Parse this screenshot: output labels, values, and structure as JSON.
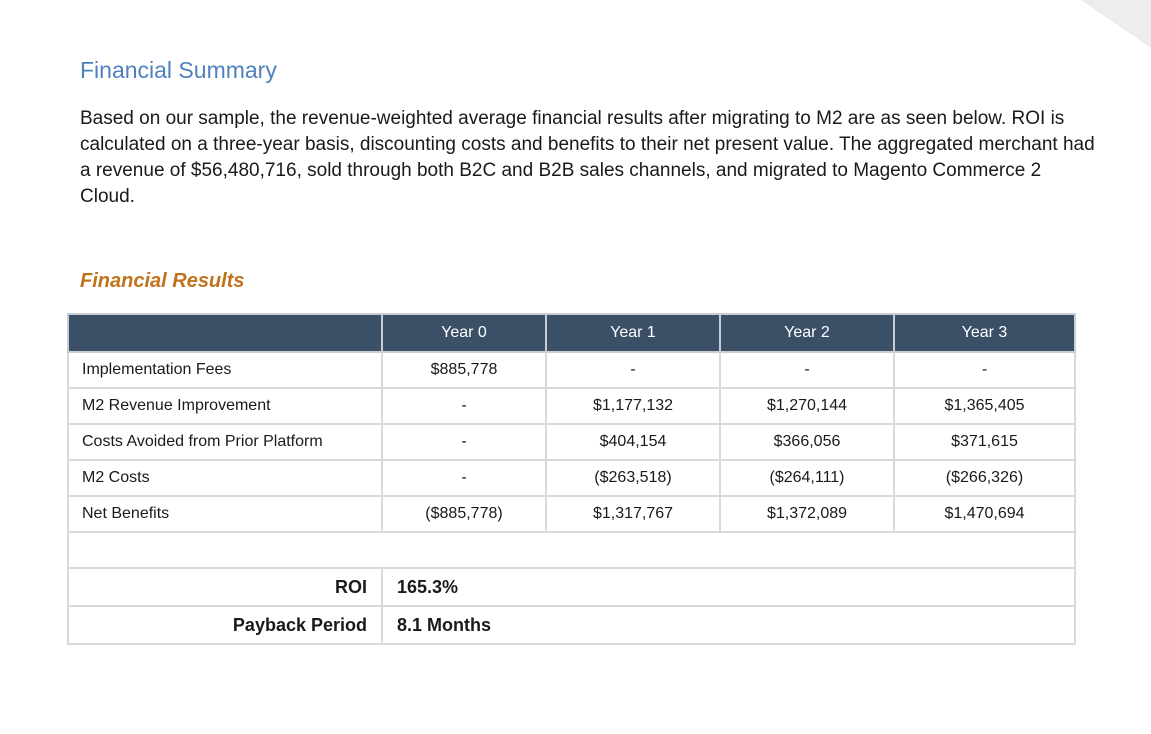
{
  "document": {
    "section_title": "Financial Summary",
    "intro_text": "Based on our sample, the revenue-weighted average financial results after migrating to M2 are as seen below. ROI is calculated on a three-year basis, discounting costs and benefits to their net present value. The aggregated merchant had a revenue of $56,480,716, sold through both B2C and B2B sales channels, and migrated to Magento Commerce 2 Cloud.",
    "table_title": "Financial Results"
  },
  "table": {
    "headers": [
      "",
      "Year 0",
      "Year 1",
      "Year 2",
      "Year 3"
    ],
    "rows": [
      {
        "label": "Implementation Fees",
        "values": [
          "$885,778",
          "-",
          "-",
          "-"
        ]
      },
      {
        "label": "M2 Revenue Improvement",
        "values": [
          "-",
          "$1,177,132",
          "$1,270,144",
          "$1,365,405"
        ]
      },
      {
        "label": "Costs Avoided from Prior Platform",
        "values": [
          "-",
          "$404,154",
          "$366,056",
          "$371,615"
        ]
      },
      {
        "label": "M2 Costs",
        "values": [
          "-",
          "($263,518)",
          "($264,111)",
          "($266,326)"
        ]
      },
      {
        "label": "Net Benefits",
        "values": [
          "($885,778)",
          "$1,317,767",
          "$1,372,089",
          "$1,470,694"
        ]
      }
    ],
    "summary": [
      {
        "label": "ROI",
        "value": "165.3%"
      },
      {
        "label": "Payback Period",
        "value": "8.1 Months"
      }
    ]
  },
  "colors": {
    "heading_blue": "#4f81bd",
    "subheading_orange": "#c0731c",
    "table_header_bg": "#3b5067",
    "grid_line": "#d9d9d9"
  }
}
